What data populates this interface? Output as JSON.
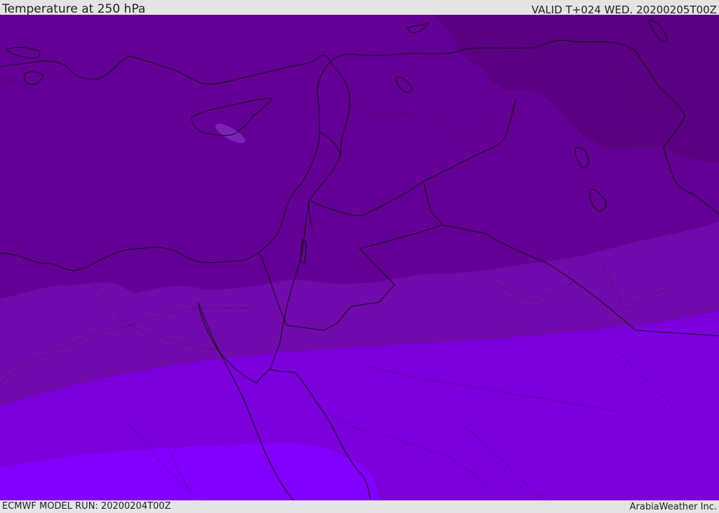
{
  "header": {
    "title": "Temperature at 250 hPa",
    "valid_time": "VALID T+024 WED. 20200205T00Z"
  },
  "footer": {
    "model_run": "ECMWF MODEL RUN: 20200204T00Z",
    "credit": "ArabiaWeather Inc."
  },
  "map": {
    "layers": [
      "temperature-fill",
      "coastlines",
      "country-borders",
      "region-borders"
    ],
    "fill_colors": {
      "darkest": "#5a0082",
      "dark": "#650096",
      "mid": "#700aaa",
      "bright": "#7b00dc",
      "brightest": "#8200ff",
      "pale_spot": "#7a22b4"
    }
  }
}
